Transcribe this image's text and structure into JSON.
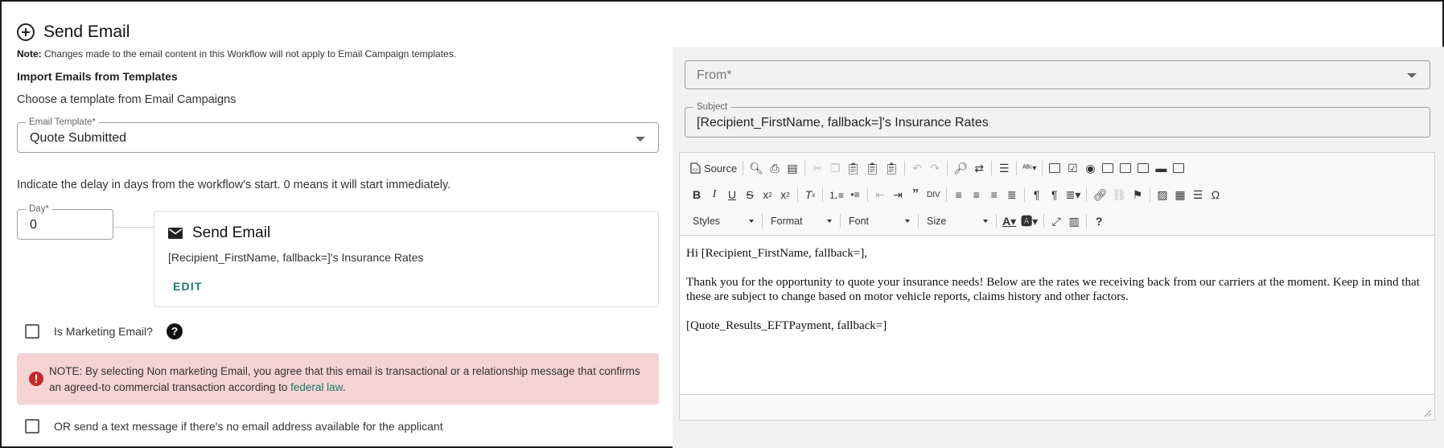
{
  "header": {
    "title": "Send Email",
    "note_label": "Note:",
    "note_text": " Changes made to the email content in this Workflow will not apply to Email Campaign templates."
  },
  "import": {
    "heading": "Import Emails from Templates",
    "subtext": "Choose a template from Email Campaigns",
    "template_label": "Email Template*",
    "template_value": "Quote Submitted"
  },
  "delay": {
    "text": "Indicate the delay in days from the workflow's start. 0 means it will start immediately.",
    "day_label": "Day*",
    "day_value": "0"
  },
  "card": {
    "title": "Send Email",
    "subject": "[Recipient_FirstName, fallback=]'s Insurance Rates",
    "edit_label": "EDIT"
  },
  "marketing": {
    "label": "Is Marketing Email?"
  },
  "alert": {
    "text": "NOTE: By selecting Non marketing Email, you agree that this email is transactional or a relationship message that confirms an agreed-to commercial transaction according to ",
    "link": "federal law",
    "tail": "."
  },
  "sms": {
    "label": "OR send a text message if there's no email address available for the applicant"
  },
  "compose": {
    "from_placeholder": "From*",
    "subject_label": "Subject",
    "subject_value": "[Recipient_FirstName, fallback=]'s Insurance Rates"
  },
  "toolbar": {
    "source_label": "Source",
    "styles_label": "Styles",
    "format_label": "Format",
    "font_label": "Font",
    "size_label": "Size"
  },
  "editor": {
    "greeting": "Hi [Recipient_FirstName, fallback=],",
    "body": "Thank you for the opportunity to quote your insurance needs! Below are the rates we receiving back from our carriers at the moment. Keep in mind that these are subject to change based on motor vehicle reports, claims history and other factors.",
    "placeholder_line": "[Quote_Results_EFTPayment, fallback=]"
  },
  "colors": {
    "accent_teal": "#1b7a72",
    "alert_bg": "#f5d3d3",
    "alert_icon": "#c62828"
  }
}
